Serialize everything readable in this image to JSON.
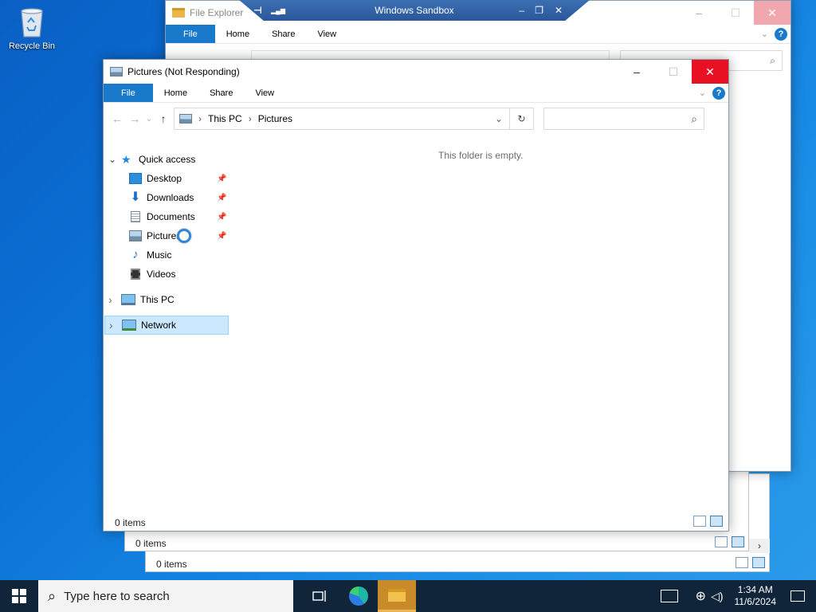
{
  "desktop": {
    "recycle_bin_label": "Recycle Bin"
  },
  "sandbox_bar": {
    "title": "Windows Sandbox",
    "pin_glyph": "⊣",
    "signal_glyph": "▂▄▆",
    "min_glyph": "–",
    "restore_glyph": "❐",
    "close_glyph": "✕"
  },
  "back_window": {
    "title": "File Explorer",
    "tabs": [
      "File",
      "Home",
      "Share",
      "View"
    ],
    "help": "?",
    "min_glyph": "–",
    "max_glyph": "☐",
    "close_glyph": "✕",
    "status_items_1": "0 items",
    "status_items_2": "0 items"
  },
  "front_window": {
    "title": "Pictures (Not Responding)",
    "min_glyph": "–",
    "max_glyph": "☐",
    "close_glyph": "✕",
    "tabs": [
      "File",
      "Home",
      "Share",
      "View"
    ],
    "help": "?",
    "expand_glyph": "⌄",
    "nav": {
      "back": "←",
      "forward": "→",
      "recent": "⌄",
      "up": "↑"
    },
    "address": {
      "crumbs": [
        "This PC",
        "Pictures"
      ],
      "separator": "›",
      "dropdown": "⌄",
      "refresh": "↻"
    },
    "search_icon_glyph": "⌕",
    "empty_message": "This folder is empty.",
    "status_items": "0 items",
    "nav_pane": {
      "quick_access": "Quick access",
      "items": [
        {
          "label": "Desktop"
        },
        {
          "label": "Downloads"
        },
        {
          "label": "Documents"
        },
        {
          "label": "Pictures"
        },
        {
          "label": "Music"
        },
        {
          "label": "Videos"
        }
      ],
      "pin_glyph": "📌",
      "this_pc": "This PC",
      "network": "Network",
      "collapse_glyph": "⌄",
      "expand_glyph": "›"
    }
  },
  "taskbar": {
    "search_placeholder": "Type here to search",
    "time": "1:34 AM",
    "date": "11/6/2024"
  },
  "colors": {
    "accent": "#1979ca",
    "close_red": "#e81123",
    "taskbar": "#10243a",
    "selection": "#cce8ff"
  }
}
